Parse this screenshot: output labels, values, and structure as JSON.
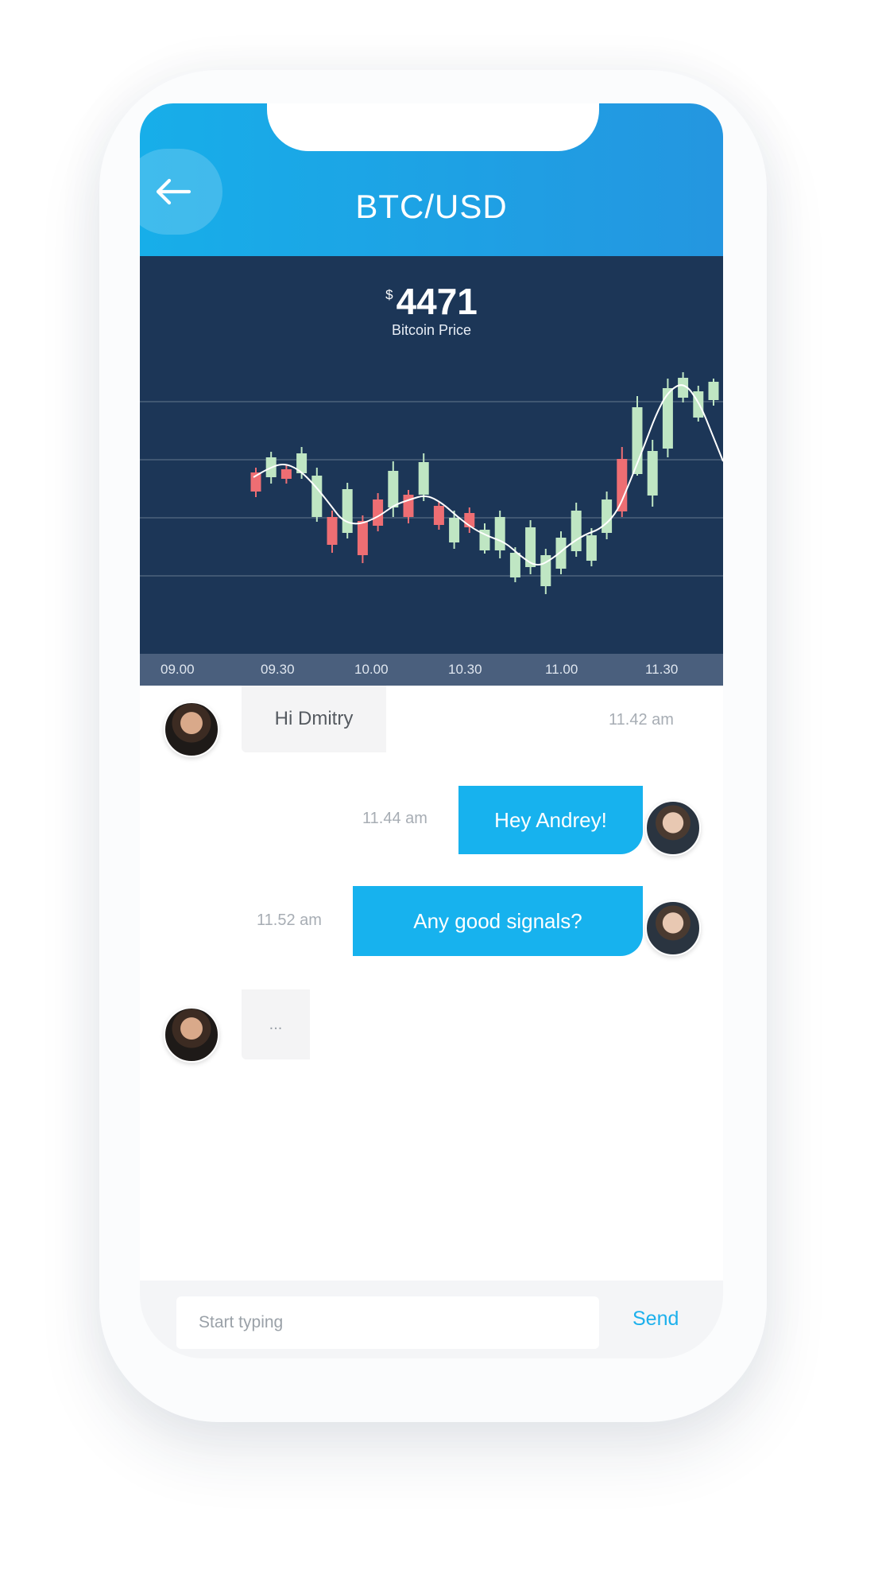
{
  "header": {
    "title": "BTC/USD",
    "back_icon": "arrow-left-icon"
  },
  "price": {
    "currency": "$",
    "value": "4471",
    "label": "Bitcoin Price"
  },
  "chart_data": {
    "type": "candlestick",
    "x_ticks": [
      "09.00",
      "09.30",
      "10.00",
      "10.30",
      "11.00",
      "11.30"
    ],
    "colors": {
      "up": "#bfe6c3",
      "down": "#ee6e73",
      "background": "#1c3657",
      "trend": "#ffffff"
    },
    "candles": [
      {
        "o": 488,
        "c": 464,
        "h": 495,
        "l": 458
      },
      {
        "o": 445,
        "c": 470,
        "h": 478,
        "l": 438
      },
      {
        "o": 472,
        "c": 460,
        "h": 478,
        "l": 455
      },
      {
        "o": 440,
        "c": 465,
        "h": 472,
        "l": 432
      },
      {
        "o": 468,
        "c": 520,
        "h": 526,
        "l": 458
      },
      {
        "o": 555,
        "c": 520,
        "h": 565,
        "l": 512
      },
      {
        "o": 485,
        "c": 540,
        "h": 547,
        "l": 477
      },
      {
        "o": 568,
        "c": 525,
        "h": 578,
        "l": 518
      },
      {
        "o": 531,
        "c": 498,
        "h": 538,
        "l": 490
      },
      {
        "o": 462,
        "c": 508,
        "h": 520,
        "l": 450
      },
      {
        "o": 520,
        "c": 492,
        "h": 528,
        "l": 486
      },
      {
        "o": 451,
        "c": 492,
        "h": 500,
        "l": 440
      },
      {
        "o": 530,
        "c": 506,
        "h": 536,
        "l": 500
      },
      {
        "o": 521,
        "c": 552,
        "h": 560,
        "l": 512
      },
      {
        "o": 533,
        "c": 515,
        "h": 540,
        "l": 508
      },
      {
        "o": 536,
        "c": 562,
        "h": 566,
        "l": 528
      },
      {
        "o": 520,
        "c": 562,
        "h": 572,
        "l": 512
      },
      {
        "o": 565,
        "c": 596,
        "h": 602,
        "l": 558
      },
      {
        "o": 533,
        "c": 583,
        "h": 592,
        "l": 524
      },
      {
        "o": 568,
        "c": 607,
        "h": 617,
        "l": 560
      },
      {
        "o": 546,
        "c": 585,
        "h": 592,
        "l": 538
      },
      {
        "o": 512,
        "c": 563,
        "h": 570,
        "l": 502
      },
      {
        "o": 543,
        "c": 575,
        "h": 582,
        "l": 534
      },
      {
        "o": 498,
        "c": 540,
        "h": 548,
        "l": 488
      },
      {
        "o": 513,
        "c": 447,
        "h": 520,
        "l": 432
      },
      {
        "o": 382,
        "c": 466,
        "h": 468,
        "l": 368
      },
      {
        "o": 437,
        "c": 493,
        "h": 507,
        "l": 423
      },
      {
        "o": 358,
        "c": 434,
        "h": 445,
        "l": 346
      },
      {
        "o": 345,
        "c": 370,
        "h": 376,
        "l": 338
      },
      {
        "o": 362,
        "c": 395,
        "h": 400,
        "l": 355
      },
      {
        "o": 350,
        "c": 373,
        "h": 380,
        "l": 346
      }
    ],
    "trend": [
      [
        143,
        470
      ],
      [
        160,
        460
      ],
      [
        180,
        452
      ],
      [
        200,
        460
      ],
      [
        220,
        480
      ],
      [
        240,
        505
      ],
      [
        255,
        525
      ],
      [
        275,
        530
      ],
      [
        300,
        520
      ],
      [
        320,
        505
      ],
      [
        340,
        498
      ],
      [
        360,
        492
      ],
      [
        380,
        502
      ],
      [
        400,
        520
      ],
      [
        420,
        535
      ],
      [
        440,
        545
      ],
      [
        460,
        552
      ],
      [
        480,
        570
      ],
      [
        500,
        583
      ],
      [
        520,
        572
      ],
      [
        540,
        555
      ],
      [
        560,
        542
      ],
      [
        580,
        535
      ],
      [
        600,
        515
      ],
      [
        615,
        480
      ],
      [
        635,
        430
      ],
      [
        650,
        390
      ],
      [
        665,
        362
      ],
      [
        685,
        350
      ],
      [
        705,
        378
      ],
      [
        720,
        415
      ],
      [
        734,
        450
      ]
    ]
  },
  "chat": {
    "messages": [
      {
        "side": "in",
        "text": "Hi Dmitry",
        "time": "11.42 am",
        "avatar": "avatar-andrey"
      },
      {
        "side": "out",
        "text": "Hey Andrey!",
        "time": "11.44 am",
        "avatar": "avatar-dmitry"
      },
      {
        "side": "out",
        "text": "Any good signals?",
        "time": "11.52 am",
        "avatar": "avatar-dmitry"
      },
      {
        "side": "in",
        "text": "...",
        "time": "",
        "avatar": "avatar-andrey"
      }
    ]
  },
  "composer": {
    "placeholder": "Start typing",
    "send_label": "Send"
  }
}
